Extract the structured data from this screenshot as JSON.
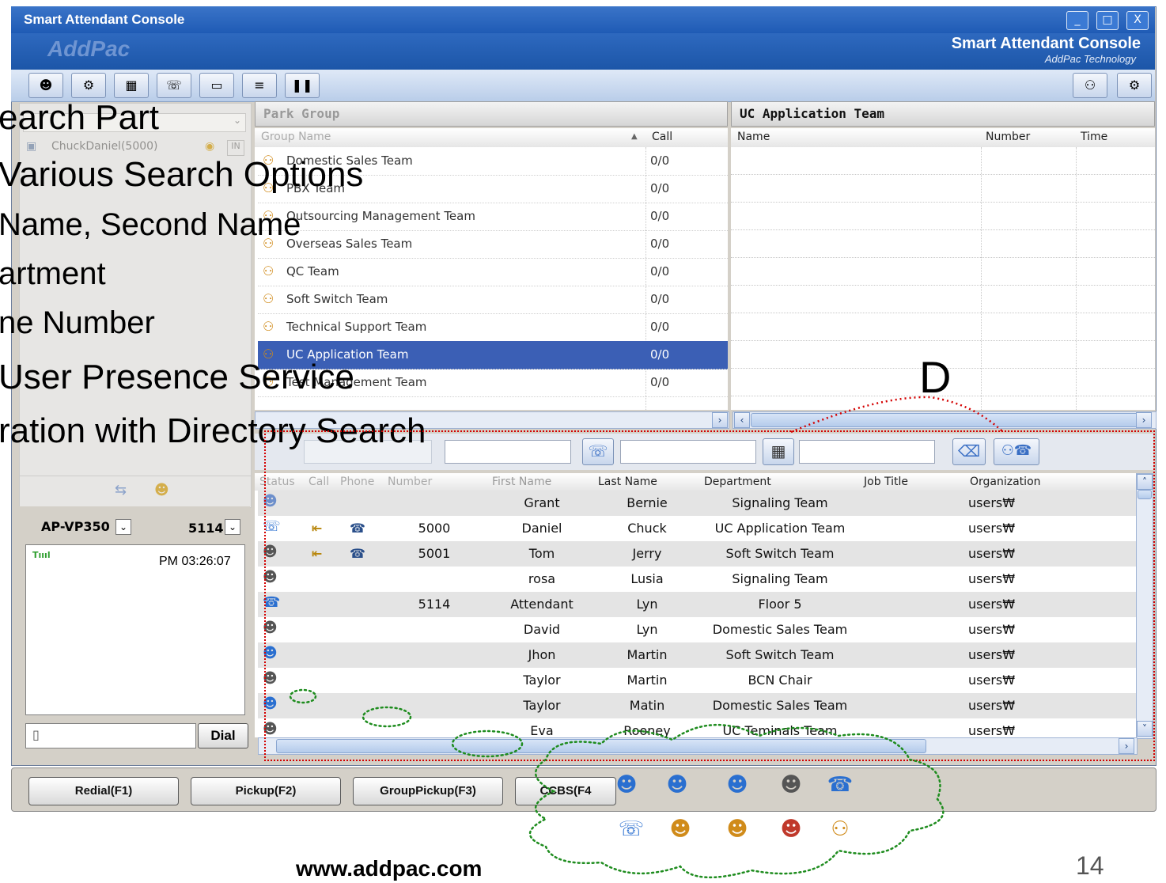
{
  "window": {
    "title": "Smart Attendant Console",
    "brand": "Smart Attendant Console",
    "brand_sub": "AddPac Technology",
    "logo_text": "AddPac",
    "controls": [
      "_",
      "□",
      "X"
    ]
  },
  "toolbar": {
    "icons": [
      "user-icon",
      "gear-icon",
      "keypad-icon",
      "phone-icon",
      "folder-icon",
      "list-icon",
      "pause-icon"
    ],
    "right_icons": [
      "group-call-icon",
      "group-settings-icon"
    ]
  },
  "search_panel": {
    "rows": [
      "ChuckDaniel(5000)",
      ""
    ],
    "badge": "IN"
  },
  "park_group": {
    "header": "Park Group",
    "col_name": "Group Name",
    "col_call": "Call",
    "groups": [
      {
        "name": "Domestic Sales Team",
        "call": "0/0"
      },
      {
        "name": "PBX Team",
        "call": "0/0"
      },
      {
        "name": "Outsourcing Management Team",
        "call": "0/0"
      },
      {
        "name": "Overseas Sales Team",
        "call": "0/0"
      },
      {
        "name": "QC Team",
        "call": "0/0"
      },
      {
        "name": "Soft Switch Team",
        "call": "0/0"
      },
      {
        "name": "Technical Support Team",
        "call": "0/0"
      },
      {
        "name": "UC Application Team",
        "call": "0/0"
      },
      {
        "name": "Test Management Team",
        "call": "0/0"
      }
    ]
  },
  "uc_panel": {
    "header": "UC Application Team",
    "col_name": "Name",
    "col_number": "Number",
    "col_time": "Time"
  },
  "phone_panel": {
    "device": "AP-VP350",
    "extension": "5114",
    "signal": "Tıııl",
    "time": "PM 03:26:07",
    "dial_label": "Dial"
  },
  "directory": {
    "columns": [
      "Status",
      "Call",
      "Phone",
      "Number",
      "First Name",
      "Last Name",
      "Department",
      "Job Title",
      "Organization"
    ],
    "rows": [
      {
        "status": "user-away-icon",
        "call": "",
        "phone": "",
        "number": "",
        "first": "Grant",
        "last": "Bernie",
        "dept": "Signaling Team",
        "org": "users₩"
      },
      {
        "status": "busy-phone-icon",
        "call": "⇤",
        "phone": "☎",
        "number": "5000",
        "first": "Daniel",
        "last": "Chuck",
        "dept": "UC Application Team",
        "org": "users₩"
      },
      {
        "status": "user-offline-icon",
        "call": "⇤",
        "phone": "☎",
        "number": "5001",
        "first": "Tom",
        "last": "Jerry",
        "dept": "Soft Switch Team",
        "org": "users₩"
      },
      {
        "status": "user-offline-icon",
        "call": "",
        "phone": "",
        "number": "",
        "first": "rosa",
        "last": "Lusia",
        "dept": "Signaling Team",
        "org": "users₩"
      },
      {
        "status": "phone-available-icon",
        "call": "",
        "phone": "",
        "number": "5114",
        "first": "Attendant",
        "last": "Lyn",
        "dept": "Floor 5",
        "org": "users₩"
      },
      {
        "status": "user-offline-icon",
        "call": "",
        "phone": "",
        "number": "",
        "first": "David",
        "last": "Lyn",
        "dept": "Domestic Sales Team",
        "org": "users₩"
      },
      {
        "status": "user-online-icon",
        "call": "",
        "phone": "",
        "number": "",
        "first": "Jhon",
        "last": "Martin",
        "dept": "Soft Switch Team",
        "org": "users₩"
      },
      {
        "status": "user-offline-icon",
        "call": "",
        "phone": "",
        "number": "",
        "first": "Taylor",
        "last": "Martin",
        "dept": "BCN Chair",
        "org": "users₩"
      },
      {
        "status": "user-online-icon",
        "call": "",
        "phone": "",
        "number": "",
        "first": "Taylor",
        "last": "Matin",
        "dept": "Domestic Sales Team",
        "org": "users₩"
      },
      {
        "status": "user-offline-icon",
        "call": "",
        "phone": "",
        "number": "",
        "first": "Eva",
        "last": "Rooney",
        "dept": "UC Teminals Team",
        "org": "users₩"
      }
    ]
  },
  "function_buttons": [
    "Redial(F1)",
    "Pickup(F2)",
    "GroupPickup(F3)",
    "CCBS(F4"
  ],
  "overlay": {
    "lines": [
      "earch Part",
      "Various Search Options",
      "Name, Second Name",
      "artment",
      "ne Number",
      "User Presence Service",
      "ration with Directory Search"
    ],
    "marker": "D"
  },
  "footer": {
    "url": "www.addpac.com",
    "page": "14"
  },
  "colors": {
    "title_blue": "#1f5bb5",
    "selection_blue": "#3b5fb5",
    "marker_red": "#d40000",
    "cloud_green": "#1e8c1e"
  }
}
